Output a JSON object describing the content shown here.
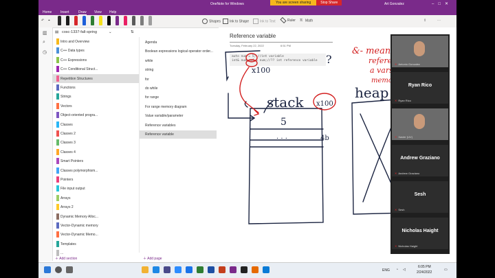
{
  "window": {
    "title": "OneNote for Windows",
    "user": "Art Gonzalez",
    "sharing_message": "You are screen sharing",
    "stop_share": "Stop Share"
  },
  "menu": [
    "Home",
    "Insert",
    "Draw",
    "View",
    "Help"
  ],
  "menu_active": "Draw",
  "ribbon": {
    "pen_colors": [
      "#2b2b2b",
      "#1c1c1c",
      "#d6262a",
      "#1e5fd9",
      "#2e7d32",
      "#f6e11c",
      "#000000",
      "#7a2a8a",
      "#e91e63",
      "#5a5a5a",
      "#7d7d7d",
      "#9e9e9e"
    ],
    "shapes": "Shapes",
    "ink_to_shape": "Ink to Shape",
    "ink_to_text": "Ink to Text",
    "ruler": "Ruler",
    "math": "Math"
  },
  "notebook": {
    "name": "cosc-1337-fall-spring"
  },
  "sections": [
    {
      "label": "Intro and Overview",
      "color": "#f6b81c"
    },
    {
      "label": "C++ Data types",
      "color": "#4a90d9"
    },
    {
      "label": "C++ Expressions",
      "color": "#8bc34a"
    },
    {
      "label": "C++ Conditional Struct...",
      "color": "#9c27b0"
    },
    {
      "label": "Repetition Structures",
      "color": "#f06292",
      "active": true
    },
    {
      "label": "Functions",
      "color": "#5c6bc0"
    },
    {
      "label": "Strings",
      "color": "#26a69a"
    },
    {
      "label": "Vectors",
      "color": "#ff7043"
    },
    {
      "label": "Object-oriented progra...",
      "color": "#7e57c2"
    },
    {
      "label": "Classes",
      "color": "#29b6f6"
    },
    {
      "label": "Classes 2",
      "color": "#ef5350"
    },
    {
      "label": "Classes 3",
      "color": "#66bb6a"
    },
    {
      "label": "Classes 4",
      "color": "#ffa726"
    },
    {
      "label": "Smart Pointers",
      "color": "#ab47bc"
    },
    {
      "label": "Classes polymorphism...",
      "color": "#42a5f5"
    },
    {
      "label": "Pointers",
      "color": "#ec407a"
    },
    {
      "label": "File input output",
      "color": "#26c6da"
    },
    {
      "label": "Arrays",
      "color": "#9ccc65"
    },
    {
      "label": "Arrays 2",
      "color": "#ffca28"
    },
    {
      "label": "Dynamic Memory Alloc...",
      "color": "#8d6e63"
    },
    {
      "label": "Vector-Dynamic memory",
      "color": "#5c6bc0"
    },
    {
      "label": "Vector-Dynamic Memo...",
      "color": "#ff7043"
    },
    {
      "label": "Templates",
      "color": "#26a69a"
    },
    {
      "label": "...",
      "color": "#bdbdbd"
    }
  ],
  "add_section": "Add section",
  "add_page": "Add page",
  "pages": [
    {
      "label": "Agenda"
    },
    {
      "label": "Boolean expressions logical operator order..."
    },
    {
      "label": "while"
    },
    {
      "label": "string"
    },
    {
      "label": "for"
    },
    {
      "label": "do while"
    },
    {
      "label": "for range"
    },
    {
      "label": "For range memory diagram"
    },
    {
      "label": "Value variable/parameter"
    },
    {
      "label": "Reference variables"
    },
    {
      "label": "Reference variable",
      "active": true
    }
  ],
  "page": {
    "title": "Reference variable",
    "date": "Tuesday, February 22, 2022",
    "time": "6:51 PM",
    "code_lines": [
      "auto num = 5; //int variable",
      "int& num_ref = num;//?? int reference variable"
    ]
  },
  "ink": {
    "stack": "stack",
    "heap": "heap",
    "x100_top": "x100",
    "x100_circle": "x100",
    "val": "5",
    "dots": ". . .",
    "hex": "4b",
    "question": "?",
    "notes": [
      "&- means",
      "reference",
      "a vars",
      "memory location"
    ]
  },
  "participants": [
    {
      "name": "Antonio Gonzalez",
      "big": "",
      "video": true
    },
    {
      "name": "Ryan Rico",
      "big": "Ryan Rico",
      "video": false
    },
    {
      "name": "Xavier (UV)",
      "big": "",
      "video": true
    },
    {
      "name": "Andrew Graziano",
      "big": "Andrew Graziano",
      "video": false
    },
    {
      "name": "Sesh",
      "big": "Sesh",
      "video": false
    },
    {
      "name": "Nicholas Haight",
      "big": "Nicholas Haight",
      "video": false
    }
  ],
  "taskbar": {
    "lang": "ENG",
    "time": "6:05 PM",
    "date": "2/24/2022"
  }
}
